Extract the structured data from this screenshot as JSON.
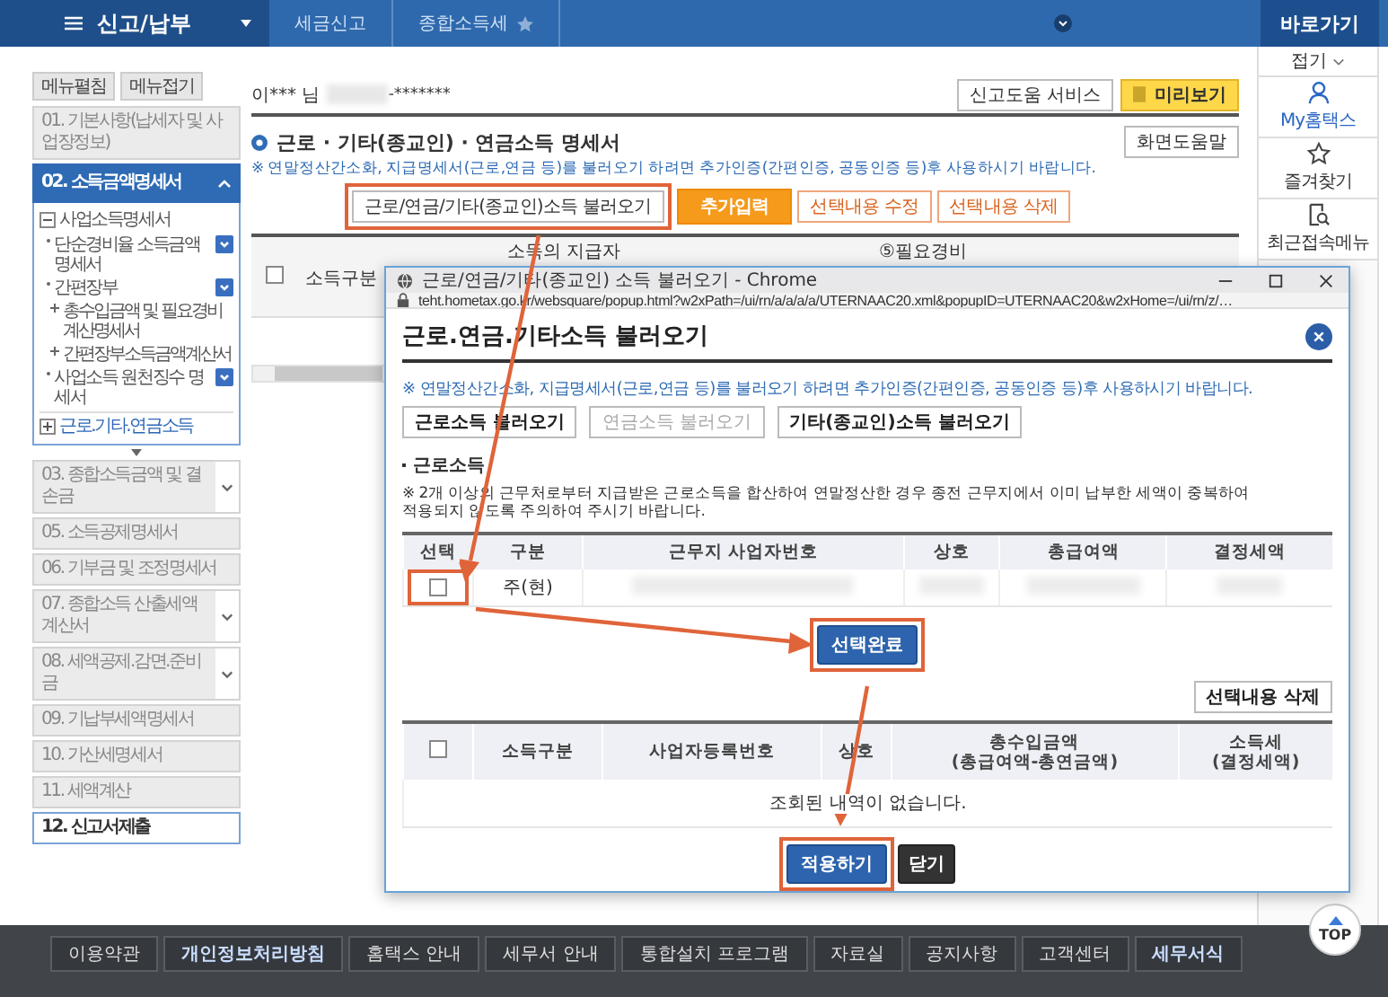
{
  "top_bar": {
    "menu_title": "신고/납부",
    "breadcrumbs": [
      "세금신고",
      "종합소득세"
    ]
  },
  "quick_panel": {
    "title": "바로가기",
    "collapse": "접기",
    "items": [
      {
        "label": "My홈택스",
        "kind": "person"
      },
      {
        "label": "즐겨찾기",
        "kind": "star"
      },
      {
        "label": "최근접속메뉴",
        "kind": "recent"
      }
    ]
  },
  "sidebar": {
    "buttons": [
      "메뉴펼침",
      "메뉴접기"
    ],
    "steps": [
      {
        "label": "01. 기본사항(납세자 및 사업장정보)",
        "selected": false,
        "disabled": true
      },
      {
        "label": "02. 소득금액명세서",
        "selected": true,
        "disabled": false,
        "expanded": true,
        "children": [
          {
            "label": "사업소득명세서",
            "expanded": true,
            "children": [
              {
                "label": "단순경비율 소득금액명세서",
                "menu": true
              },
              {
                "label": "간편장부",
                "menu": true,
                "children": [
                  {
                    "label": "총수입금액 및 필요경비 계산명세서"
                  },
                  {
                    "label": "간편장부소득금액계산서"
                  }
                ]
              },
              {
                "label": "사업소득 원천징수 명세서",
                "menu": true
              }
            ]
          },
          {
            "label": "근로.기타.연금소득",
            "expanded": false
          }
        ]
      },
      {
        "label": "03. 종합소득금액 및 결손금",
        "selected": false,
        "disabled": true,
        "expanded": false
      },
      {
        "label": "05. 소득공제명세서",
        "selected": false,
        "disabled": true
      },
      {
        "label": "06. 기부금 및 조정명세서",
        "selected": false,
        "disabled": true
      },
      {
        "label": "07. 종합소득 산출세액계산서",
        "selected": false,
        "disabled": true,
        "expanded": false
      },
      {
        "label": "08. 세액공제.감면.준비금",
        "selected": false,
        "disabled": true,
        "expanded": false
      },
      {
        "label": "09. 기납부세액명세서",
        "selected": false,
        "disabled": true
      },
      {
        "label": "10. 가산세명세서",
        "selected": false,
        "disabled": true
      },
      {
        "label": "11. 세액계산",
        "selected": false,
        "disabled": true
      },
      {
        "label": "12. 신고서제출",
        "selected": false,
        "disabled": false
      }
    ]
  },
  "user": {
    "name": "이*** 님",
    "id_suffix": "-*******"
  },
  "header_buttons": [
    {
      "label": "신고도움 서비스",
      "kind": "plain"
    },
    {
      "label": "미리보기",
      "kind": "preview"
    }
  ],
  "section": {
    "title": "근로 · 기타(종교인) · 연금소득 명세서",
    "help": "화면도움말",
    "notice": "※ 연말정산간소화, 지급명세서(근로,연금 등)를 불러오기 하려면 추가인증(간편인증, 공동인증 등)후 사용하시기 바랍니다.",
    "actions": [
      {
        "label": "근로/연금/기타(종교인)소득 불러오기",
        "kind": "plain"
      },
      {
        "label": "추가입력",
        "kind": "primary"
      },
      {
        "label": "선택내용 수정",
        "kind": "outline"
      },
      {
        "label": "선택내용 삭제",
        "kind": "outline"
      }
    ],
    "table": {
      "all_checked": false,
      "columns": [
        "소득구분",
        "소득의 지급자",
        "⑤필요경비"
      ]
    }
  },
  "popup": {
    "window_title": "근로/연금/기타(종교인) 소득 불러오기 - Chrome",
    "url": "teht.hometax.go.kr/websquare/popup.html?w2xPath=/ui/rn/a/a/a/a/UTERNAAC20.xml&popupID=UTERNAAC20&w2xHome=/ui/rn/z/…",
    "title": "근로.연금.기타소득 불러오기",
    "notice": "※ 연말정산간소화, 지급명세서(근로,연금 등)를 불러오기 하려면 추가인증(간편인증, 공동인증 등)후 사용하시기 바랍니다.",
    "load_buttons": [
      {
        "label": "근로소득 불러오기",
        "disabled": false
      },
      {
        "label": "연금소득 불러오기",
        "disabled": true
      },
      {
        "label": "기타(종교인)소득 불러오기",
        "disabled": false
      }
    ],
    "subheading": "근로소득",
    "warning": "※ 2개 이상의 근무처로부터 지급받은 근로소득을 합산하여 연말정산한 경우 종전 근무지에서 이미 납부한 세액이 중복하여\n적용되지 않도록 주의하여 주시기 바랍니다.",
    "income_table": {
      "columns": [
        "선택",
        "구분",
        "근무지 사업자번호",
        "상호",
        "총급여액",
        "결정세액"
      ],
      "rows": [
        {
          "checked": false,
          "type": "주(현)"
        }
      ]
    },
    "complete_button": "선택완료",
    "delete_button": "선택내용 삭제",
    "result_table": {
      "all_checked": false,
      "columns": [
        "소득구분",
        "사업자등록번호",
        "상호",
        "총수입금액\n(총급여액-총연금액)",
        "소득세\n(결정세액)"
      ],
      "empty": "조회된 내역이 없습니다."
    },
    "apply_button": "적용하기",
    "close_button": "닫기"
  },
  "footer": {
    "links": [
      {
        "label": "이용약관",
        "kind": "plain"
      },
      {
        "label": "개인정보처리방침",
        "kind": "emphasis"
      },
      {
        "label": "홈택스 안내",
        "kind": "plain"
      },
      {
        "label": "세무서 안내",
        "kind": "plain"
      },
      {
        "label": "통합설치 프로그램",
        "kind": "plain"
      },
      {
        "label": "자료실",
        "kind": "plain"
      },
      {
        "label": "공지사항",
        "kind": "plain"
      },
      {
        "label": "고객센터",
        "kind": "plain"
      },
      {
        "label": "세무서식",
        "kind": "emphasis"
      }
    ],
    "top": "TOP"
  }
}
